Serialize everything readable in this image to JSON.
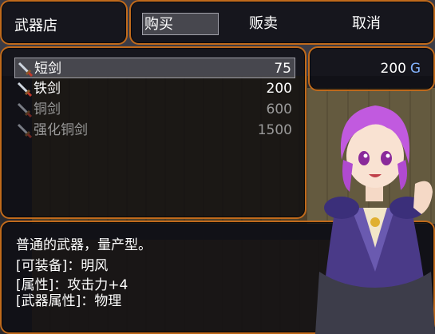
{
  "shop": {
    "title": "武器店"
  },
  "commands": {
    "buy": "购买",
    "sell": "贩卖",
    "cancel": "取消"
  },
  "items": [
    {
      "name": "短剑",
      "price": "75",
      "selected": true,
      "enabled": true,
      "icon": "sword-icon"
    },
    {
      "name": "铁剑",
      "price": "200",
      "selected": false,
      "enabled": true,
      "icon": "sword-icon"
    },
    {
      "name": "铜剑",
      "price": "600",
      "selected": false,
      "enabled": false,
      "icon": "sword-icon"
    },
    {
      "name": "强化铜剑",
      "price": "1500",
      "selected": false,
      "enabled": false,
      "icon": "sword-icon"
    }
  ],
  "gold": {
    "amount": "200",
    "unit": "G"
  },
  "description": {
    "line1": "普通的武器，量产型。",
    "line2": "[可装备]：明风",
    "line3": "[属性]：攻击力+4",
    "line4": "[武器属性]：物理"
  },
  "colors": {
    "frame": "#c06a1c",
    "gold_unit": "#84b4ff",
    "disabled_text": "#9a9a9a"
  }
}
